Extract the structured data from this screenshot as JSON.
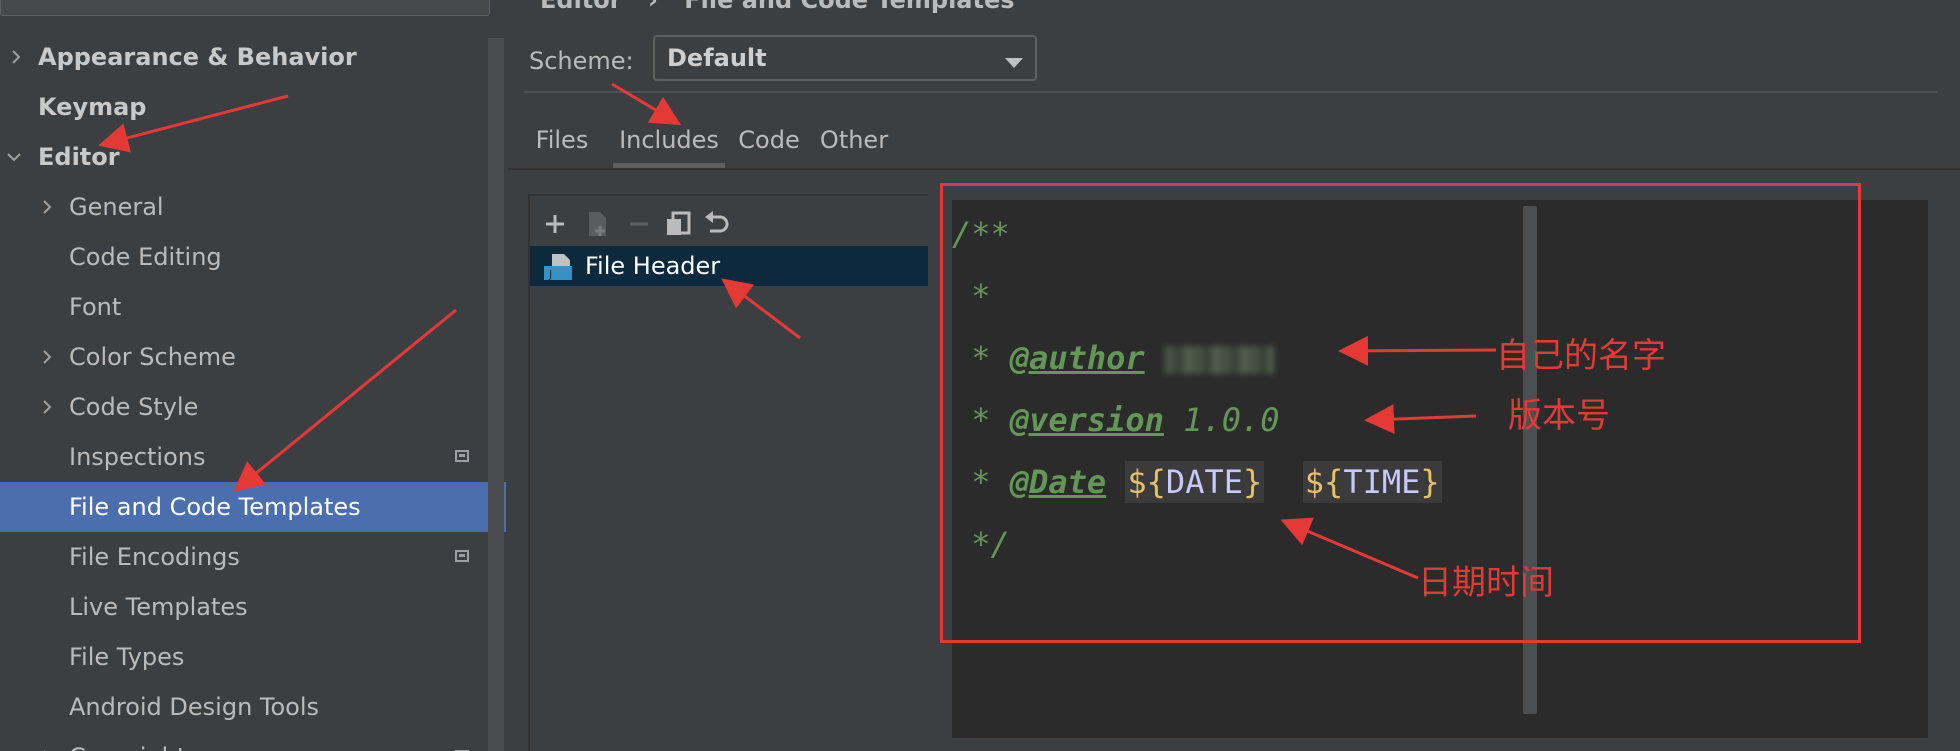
{
  "breadcrumb": {
    "parent": "Editor",
    "separator": "›",
    "current": "File and Code Templates"
  },
  "sidebar": {
    "items": [
      {
        "label": "Appearance & Behavior",
        "level": 0,
        "expander": "collapsed",
        "bold": true
      },
      {
        "label": "Keymap",
        "level": 0,
        "expander": "none",
        "bold": true
      },
      {
        "label": "Editor",
        "level": 0,
        "expander": "expanded",
        "bold": true
      },
      {
        "label": "General",
        "level": 1,
        "expander": "collapsed"
      },
      {
        "label": "Code Editing",
        "level": 1,
        "expander": "none"
      },
      {
        "label": "Font",
        "level": 1,
        "expander": "none"
      },
      {
        "label": "Color Scheme",
        "level": 1,
        "expander": "collapsed"
      },
      {
        "label": "Code Style",
        "level": 1,
        "expander": "collapsed"
      },
      {
        "label": "Inspections",
        "level": 1,
        "expander": "none",
        "badge": true
      },
      {
        "label": "File and Code Templates",
        "level": 1,
        "expander": "none",
        "selected": true
      },
      {
        "label": "File Encodings",
        "level": 1,
        "expander": "none",
        "badge": true
      },
      {
        "label": "Live Templates",
        "level": 1,
        "expander": "none"
      },
      {
        "label": "File Types",
        "level": 1,
        "expander": "none"
      },
      {
        "label": "Android Design Tools",
        "level": 1,
        "expander": "none"
      },
      {
        "label": "Copyright",
        "level": 1,
        "expander": "collapsed",
        "badge": true
      }
    ]
  },
  "scheme": {
    "label": "Scheme:",
    "value": "Default"
  },
  "tabs": [
    {
      "label": "Files",
      "active": false
    },
    {
      "label": "Includes",
      "active": true
    },
    {
      "label": "Code",
      "active": false
    },
    {
      "label": "Other",
      "active": false
    }
  ],
  "toolbar": {
    "add": "plus-icon",
    "add_child": "add-file-icon",
    "remove": "minus-icon",
    "copy": "copy-icon",
    "reset": "undo-icon"
  },
  "templates": [
    {
      "label": "File Header",
      "selected": true
    }
  ],
  "editor": {
    "line1": "/**",
    "line2": " *",
    "line3_prefix": " * ",
    "line3_tag": "@author",
    "line4_prefix": " * ",
    "line4_tag": "@version",
    "line4_value": " 1.0.0",
    "line5_prefix": " * ",
    "line5_tag": "@Date",
    "var_date_dollar": "${",
    "var_date_name": "DATE",
    "var_date_close": "}",
    "var_time_dollar": "${",
    "var_time_name": "TIME",
    "var_time_close": "}",
    "line6": " */"
  },
  "annotations": {
    "author_note": "自己的名字",
    "version_note": "版本号",
    "date_note": "日期时间",
    "color": "#e53935"
  },
  "colors": {
    "selection": "#4b6eaf",
    "comment": "#629755",
    "template_var": "#c8c8ff",
    "dollar": "#e8bf6a",
    "editor_bg": "#2b2b2b",
    "panel_bg": "#3c3f41"
  }
}
